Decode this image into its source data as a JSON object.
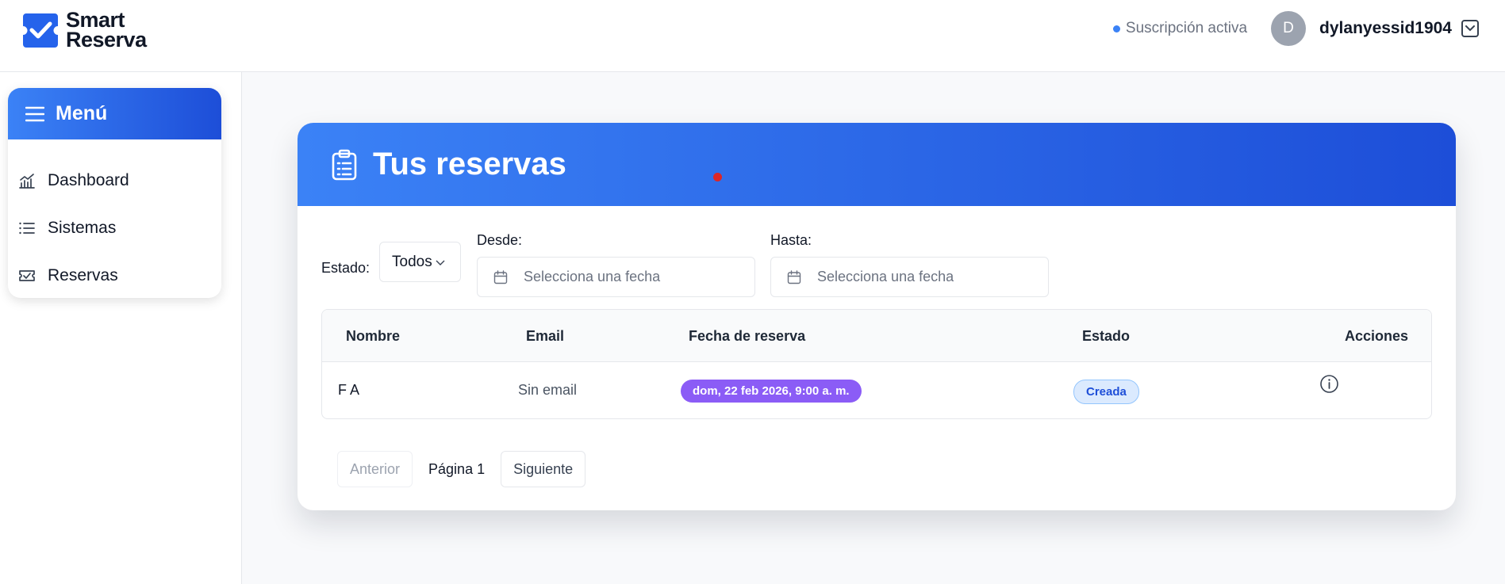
{
  "brand": {
    "line1": "Smart",
    "line2": "Reserva",
    "color": "#2563eb"
  },
  "header": {
    "subscription_status": "Suscripción activa",
    "avatar_initial": "D",
    "username": "dylanyessid1904"
  },
  "sidebar": {
    "title": "Menú",
    "items": [
      {
        "label": "Dashboard",
        "icon": "chart-icon"
      },
      {
        "label": "Sistemas",
        "icon": "list-icon"
      },
      {
        "label": "Reservas",
        "icon": "ticket-icon"
      }
    ]
  },
  "main": {
    "title": "Tus reservas",
    "filters": {
      "estado_label": "Estado:",
      "estado_value": "Todos",
      "desde_label": "Desde:",
      "desde_placeholder": "Selecciona una fecha",
      "hasta_label": "Hasta:",
      "hasta_placeholder": "Selecciona una fecha"
    },
    "table": {
      "columns": [
        "Nombre",
        "Email",
        "Fecha de reserva",
        "Estado",
        "Acciones"
      ],
      "rows": [
        {
          "nombre": "F A",
          "email": "Sin email",
          "fecha": "dom, 22 feb 2026, 9:00 a. m.",
          "estado": "Creada"
        }
      ]
    },
    "pagination": {
      "prev": "Anterior",
      "page_label": "Página 1",
      "next": "Siguiente"
    }
  },
  "colors": {
    "accent_start": "#3b82f6",
    "accent_end": "#1d4ed8",
    "date_pill": "#8b5cf6",
    "status_pill_bg": "#dbeafe",
    "status_pill_text": "#1d4ed8"
  }
}
